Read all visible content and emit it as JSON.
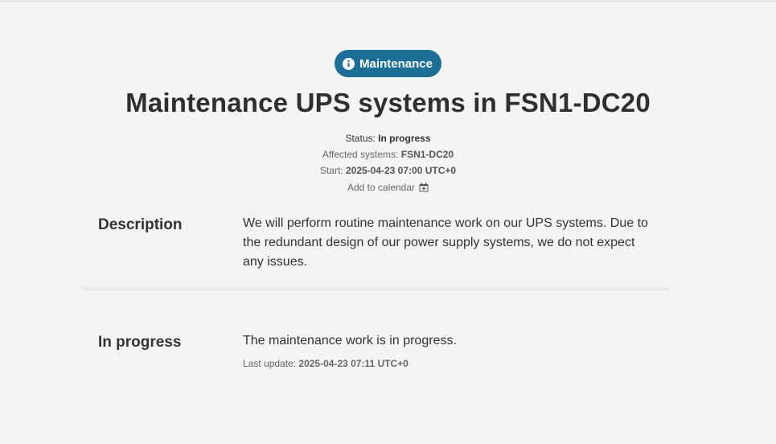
{
  "badge": {
    "label": "Maintenance",
    "icon": "info-icon",
    "color": "#1c6f97"
  },
  "title": "Maintenance UPS systems in FSN1-DC20",
  "meta": {
    "status_label": "Status:",
    "status_value": "In progress",
    "affected_label": "Affected systems:",
    "affected_value": "FSN1-DC20",
    "start_label": "Start:",
    "start_value": "2025-04-23 07:00 UTC+0",
    "calendar_label": "Add to calendar",
    "calendar_icon": "calendar-plus-icon"
  },
  "description": {
    "label": "Description",
    "text": "We will perform routine maintenance work on our UPS systems. Due to the redundant design of our power supply systems, we do not expect any issues."
  },
  "updates": [
    {
      "label": "In progress",
      "text": "The maintenance work is in progress.",
      "last_update_label": "Last update:",
      "last_update_value": "2025-04-23 07:11 UTC+0"
    }
  ]
}
